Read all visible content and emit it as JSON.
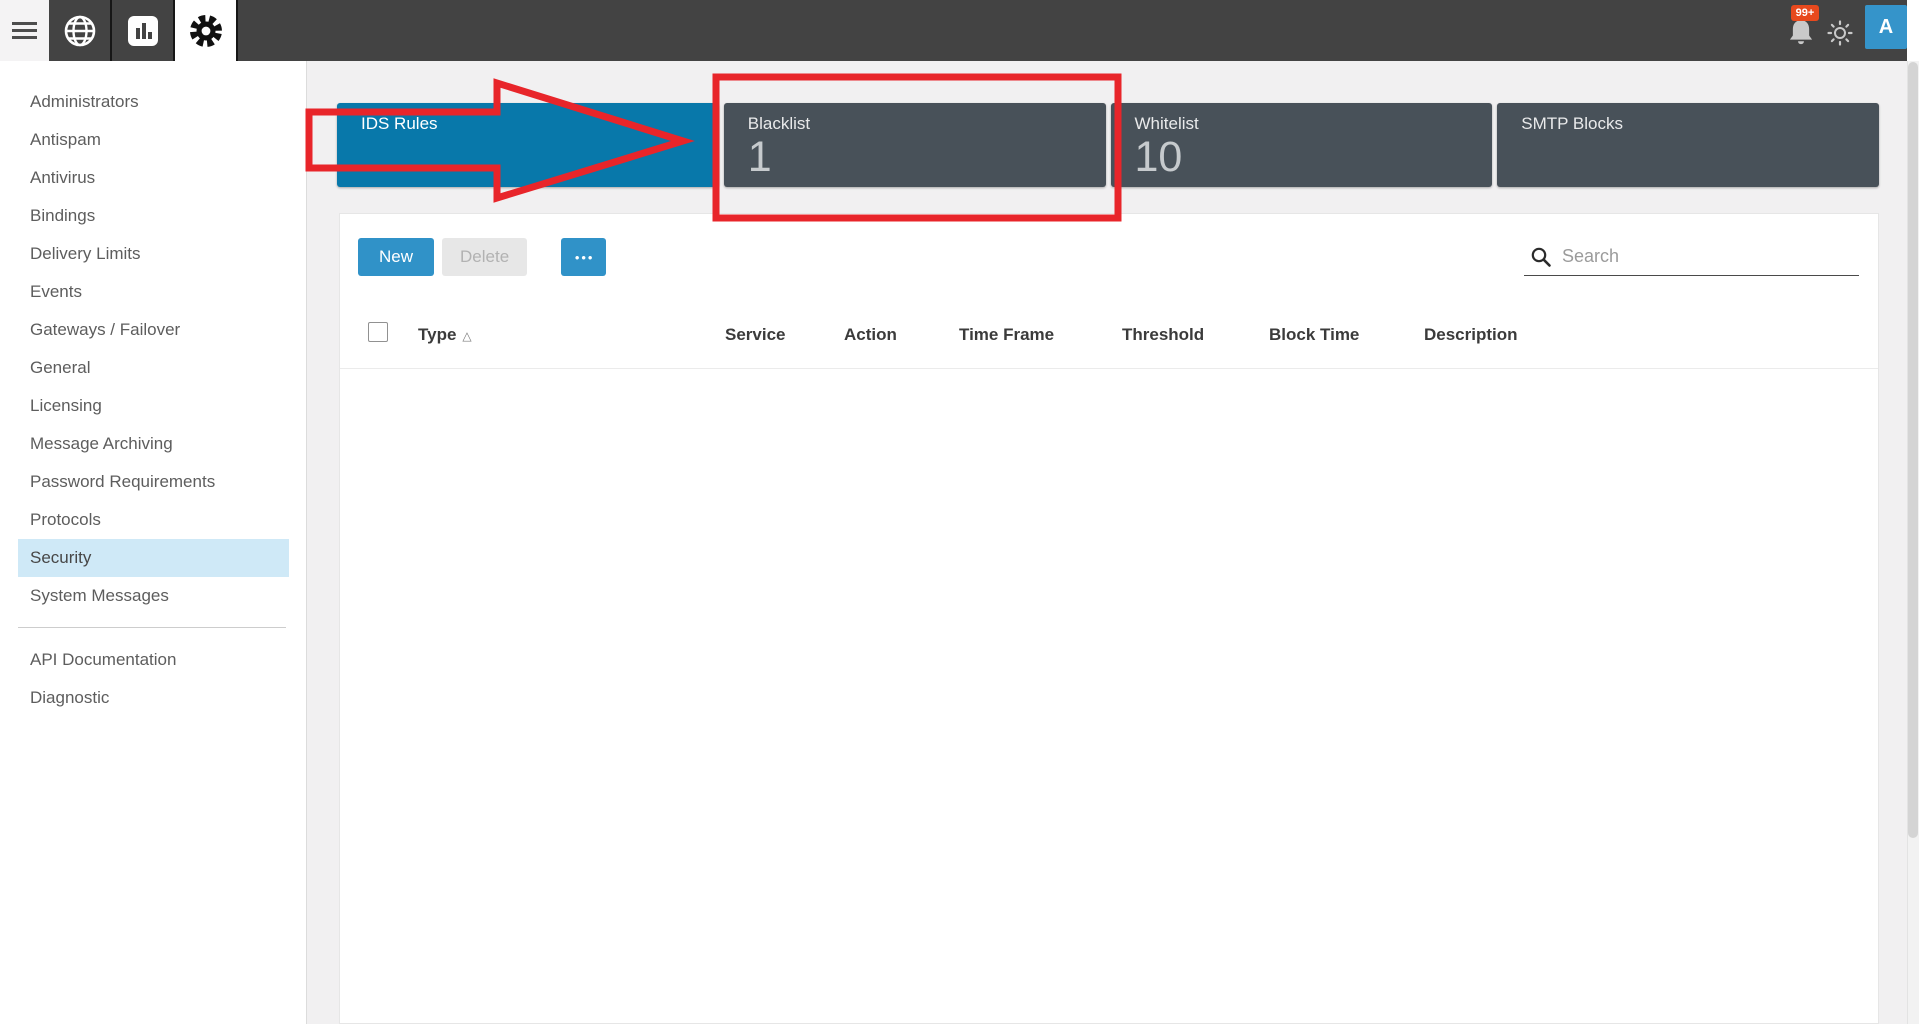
{
  "topbar": {
    "notification_badge": "99+",
    "avatar_initial": "A"
  },
  "sidebar": {
    "items": [
      "Administrators",
      "Antispam",
      "Antivirus",
      "Bindings",
      "Delivery Limits",
      "Events",
      "Gateways / Failover",
      "General",
      "Licensing",
      "Message Archiving",
      "Password Requirements",
      "Protocols",
      "Security",
      "System Messages"
    ],
    "selected": "Security",
    "secondary_items": [
      "API Documentation",
      "Diagnostic"
    ]
  },
  "cards": [
    {
      "label": "IDS Rules",
      "count": "",
      "active": true
    },
    {
      "label": "Blacklist",
      "count": "1",
      "active": false
    },
    {
      "label": "Whitelist",
      "count": "10",
      "active": false
    },
    {
      "label": "SMTP Blocks",
      "count": "",
      "active": false
    }
  ],
  "toolbar": {
    "new_label": "New",
    "delete_label": "Delete",
    "more_label": "•••",
    "search_placeholder": "Search",
    "search_value": ""
  },
  "table": {
    "columns": [
      "Type",
      "Service",
      "Action",
      "Time Frame",
      "Threshold",
      "Block Time",
      "Description"
    ],
    "sort_column": "Type",
    "sort_direction": "ascending",
    "sort_indicator": "△",
    "rows": []
  },
  "annotations": {
    "shapes": [
      "arrow-pointing-to-blacklist",
      "rectangle-around-blacklist-card"
    ]
  },
  "colors": {
    "topbar_bg": "#434343",
    "accent_blue": "#0878aa",
    "button_blue": "#3092c8",
    "card_dark": "#485159",
    "selected_item_bg": "#cfe9f7",
    "annotation_red": "#e8252a",
    "badge_red": "#e8491d"
  }
}
